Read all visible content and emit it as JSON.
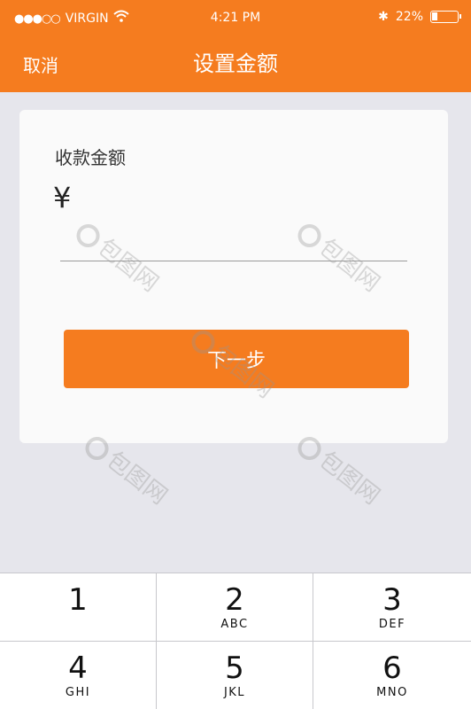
{
  "status_bar": {
    "signal": "●●●○○",
    "carrier": "VIRGIN",
    "time": "4:21 PM",
    "bluetooth": "✱",
    "battery_text": "22%",
    "battery_level": 0.22
  },
  "nav": {
    "cancel_label": "取消",
    "title": "设置金额"
  },
  "card": {
    "amount_label": "收款金额",
    "currency_symbol": "¥",
    "amount_value": "",
    "next_label": "下一步"
  },
  "keypad": {
    "keys": [
      {
        "num": "1",
        "letters": ""
      },
      {
        "num": "2",
        "letters": "ABC"
      },
      {
        "num": "3",
        "letters": "DEF"
      },
      {
        "num": "4",
        "letters": "GHI"
      },
      {
        "num": "5",
        "letters": "JKL"
      },
      {
        "num": "6",
        "letters": "MNO"
      }
    ]
  },
  "watermark_text": "包图网",
  "colors": {
    "accent": "#f57c1f",
    "background": "#e6e6ec"
  }
}
